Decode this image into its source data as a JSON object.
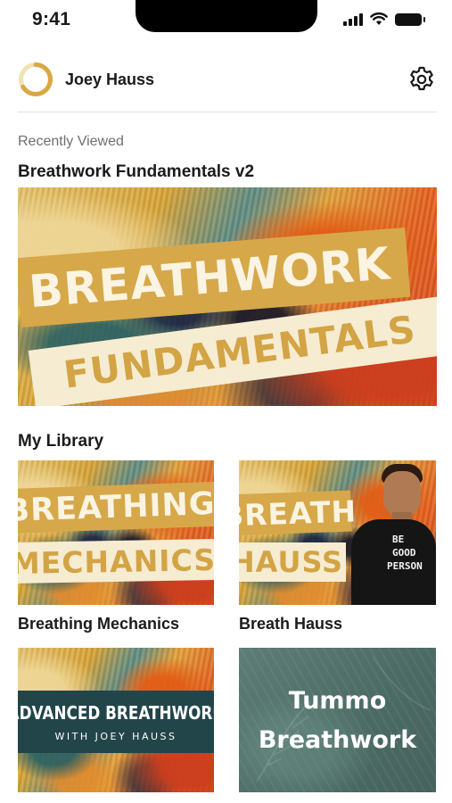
{
  "status_bar": {
    "time": "9:41"
  },
  "profile": {
    "name": "Joey Hauss"
  },
  "recent": {
    "caption": "Recently Viewed",
    "title": "Breathwork Fundamentals v2",
    "banner_line1": "BREATHWORK",
    "banner_line2": "FUNDAMENTALS"
  },
  "library": {
    "heading": "My Library",
    "cards": [
      {
        "label": "Breathing Mechanics",
        "art_line1": "BREATHING",
        "art_line2": "MECHANICS"
      },
      {
        "label": "Breath Hauss",
        "art_line1": "BREATH",
        "art_line2": "HAUSS",
        "shirt_text": [
          "BE",
          "GOOD",
          "PERSON"
        ]
      },
      {
        "art_line1": "ADVANCED BREATHWORK",
        "art_line2": "WITH JOEY HAUSS"
      },
      {
        "art_line1": "Tummo",
        "art_line2": "Breathwork"
      }
    ]
  },
  "colors": {
    "accent_gold": "#d6a84a",
    "cream": "#f6ecd2",
    "teal_dark": "#22454a",
    "tummo_green": "#557571"
  }
}
